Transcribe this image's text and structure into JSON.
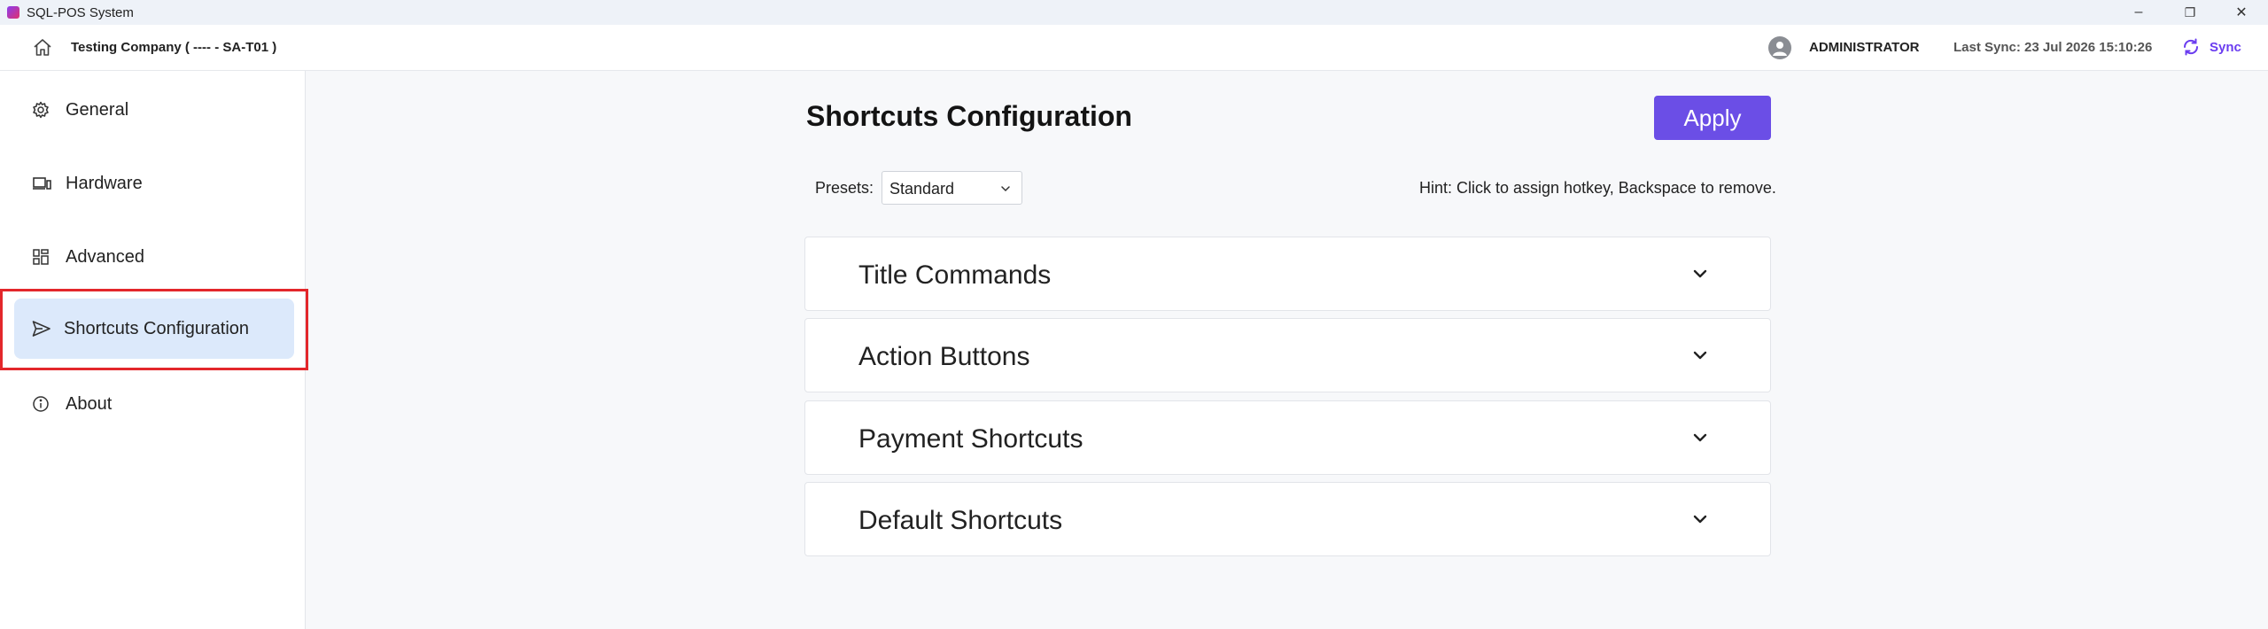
{
  "window": {
    "title": "SQL-POS System",
    "controls": {
      "minimize": "–",
      "maximize": "❐",
      "close": "✕"
    }
  },
  "header": {
    "company": "Testing Company ( ---- - SA-T01 )",
    "user": "ADMINISTRATOR",
    "last_sync": "Last Sync: 23 Jul 2026 15:10:26",
    "sync_label": "Sync",
    "accent_color": "#6b3df0"
  },
  "sidebar": {
    "items": [
      {
        "label": "General",
        "icon": "gear-icon",
        "active": false
      },
      {
        "label": "Hardware",
        "icon": "laptop-icon",
        "active": false
      },
      {
        "label": "Advanced",
        "icon": "grid-icon",
        "active": false
      },
      {
        "label": "Shortcuts Configuration",
        "icon": "send-icon",
        "active": true
      },
      {
        "label": "About",
        "icon": "info-icon",
        "active": false
      }
    ]
  },
  "main": {
    "title": "Shortcuts Configuration",
    "apply_label": "Apply",
    "presets_label": "Presets:",
    "presets_value": "Standard",
    "hint": "Hint: Click to assign hotkey, Backspace to remove.",
    "sections": [
      {
        "title": "Title Commands"
      },
      {
        "title": "Action Buttons"
      },
      {
        "title": "Payment Shortcuts"
      },
      {
        "title": "Default Shortcuts"
      }
    ]
  },
  "colors": {
    "apply_button": "#6b4ee6",
    "active_nav": "#dce9fb",
    "highlight": "#e3272b"
  }
}
